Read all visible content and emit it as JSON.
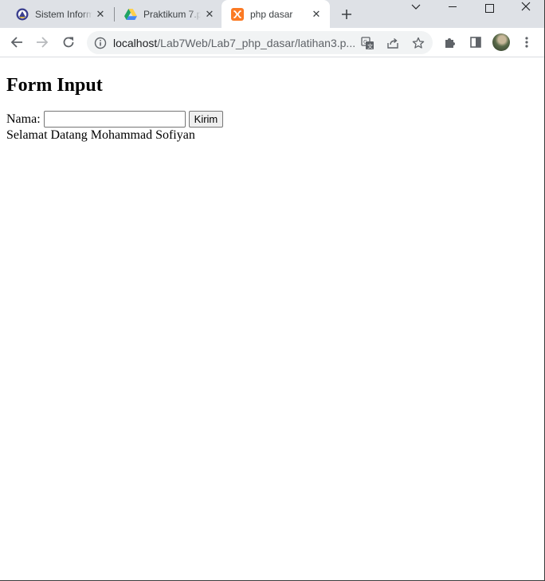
{
  "browser": {
    "tabs": [
      {
        "title": "Sistem Inform",
        "icon": "university-logo-icon",
        "active": false
      },
      {
        "title": "Praktikum 7.p",
        "icon": "google-drive-icon",
        "active": false
      },
      {
        "title": "php dasar",
        "icon": "xampp-icon",
        "active": true
      }
    ],
    "address_bar": {
      "host": "localhost",
      "path": "/Lab7Web/Lab7_php_dasar/latihan3.p..."
    }
  },
  "page": {
    "title": "Form Input",
    "form": {
      "name_label": "Nama:",
      "name_value": "",
      "submit_label": "Kirim"
    },
    "greeting": "Selamat Datang Mohammad Sofiyan"
  },
  "colors": {
    "tabstrip": "#dee1e6",
    "omnibox": "#f1f3f4",
    "xampp_orange": "#fb7a24",
    "drive_green": "#1fa463",
    "drive_yellow": "#ffd04b",
    "drive_blue": "#4688f4"
  }
}
